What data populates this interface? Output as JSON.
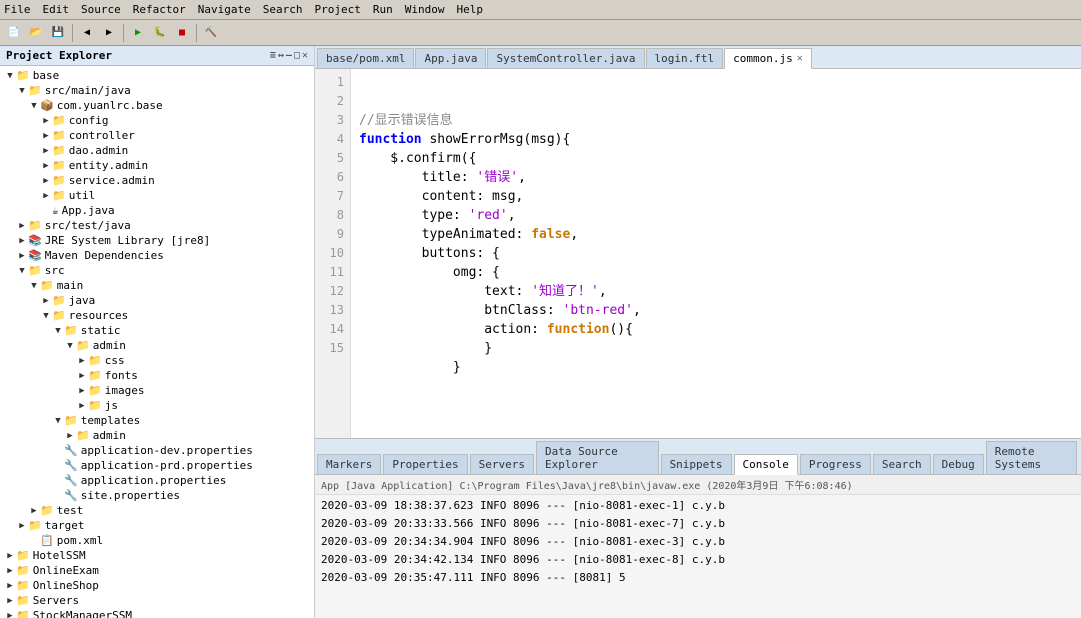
{
  "menubar": {
    "items": [
      "File",
      "Edit",
      "Source",
      "Refactor",
      "Navigate",
      "Search",
      "Project",
      "Run",
      "Window",
      "Help"
    ]
  },
  "sidebar": {
    "title": "Project Explorer",
    "tree": [
      {
        "indent": 0,
        "arrow": "▼",
        "icon": "📁",
        "label": "base",
        "type": "folder"
      },
      {
        "indent": 1,
        "arrow": "▼",
        "icon": "📁",
        "label": "src/main/java",
        "type": "folder"
      },
      {
        "indent": 2,
        "arrow": "▼",
        "icon": "📦",
        "label": "com.yuanlrc.base",
        "type": "package"
      },
      {
        "indent": 3,
        "arrow": "▶",
        "icon": "📁",
        "label": "config",
        "type": "folder"
      },
      {
        "indent": 3,
        "arrow": "▶",
        "icon": "📁",
        "label": "controller",
        "type": "folder"
      },
      {
        "indent": 3,
        "arrow": "▶",
        "icon": "📁",
        "label": "dao.admin",
        "type": "folder"
      },
      {
        "indent": 3,
        "arrow": "▶",
        "icon": "📁",
        "label": "entity.admin",
        "type": "folder"
      },
      {
        "indent": 3,
        "arrow": "▶",
        "icon": "📁",
        "label": "service.admin",
        "type": "folder"
      },
      {
        "indent": 3,
        "arrow": "▶",
        "icon": "📁",
        "label": "util",
        "type": "folder"
      },
      {
        "indent": 3,
        "arrow": "",
        "icon": "☕",
        "label": "App.java",
        "type": "file"
      },
      {
        "indent": 1,
        "arrow": "▶",
        "icon": "📁",
        "label": "src/test/java",
        "type": "folder"
      },
      {
        "indent": 1,
        "arrow": "▶",
        "icon": "📚",
        "label": "JRE System Library [jre8]",
        "type": "lib"
      },
      {
        "indent": 1,
        "arrow": "▶",
        "icon": "📚",
        "label": "Maven Dependencies",
        "type": "lib"
      },
      {
        "indent": 1,
        "arrow": "▼",
        "icon": "📁",
        "label": "src",
        "type": "folder"
      },
      {
        "indent": 2,
        "arrow": "▼",
        "icon": "📁",
        "label": "main",
        "type": "folder"
      },
      {
        "indent": 3,
        "arrow": "▶",
        "icon": "📁",
        "label": "java",
        "type": "folder"
      },
      {
        "indent": 3,
        "arrow": "▼",
        "icon": "📁",
        "label": "resources",
        "type": "folder"
      },
      {
        "indent": 4,
        "arrow": "▼",
        "icon": "📁",
        "label": "static",
        "type": "folder"
      },
      {
        "indent": 5,
        "arrow": "▼",
        "icon": "📁",
        "label": "admin",
        "type": "folder"
      },
      {
        "indent": 6,
        "arrow": "▶",
        "icon": "📁",
        "label": "css",
        "type": "folder"
      },
      {
        "indent": 6,
        "arrow": "▶",
        "icon": "📁",
        "label": "fonts",
        "type": "folder"
      },
      {
        "indent": 6,
        "arrow": "▶",
        "icon": "📁",
        "label": "images",
        "type": "folder"
      },
      {
        "indent": 6,
        "arrow": "▶",
        "icon": "📁",
        "label": "js",
        "type": "folder"
      },
      {
        "indent": 4,
        "arrow": "▼",
        "icon": "📁",
        "label": "templates",
        "type": "folder"
      },
      {
        "indent": 5,
        "arrow": "▶",
        "icon": "📁",
        "label": "admin",
        "type": "folder"
      },
      {
        "indent": 4,
        "arrow": "",
        "icon": "📄",
        "label": "application-dev.properties",
        "type": "file"
      },
      {
        "indent": 4,
        "arrow": "",
        "icon": "📄",
        "label": "application-prd.properties",
        "type": "file"
      },
      {
        "indent": 4,
        "arrow": "",
        "icon": "📄",
        "label": "application.properties",
        "type": "file"
      },
      {
        "indent": 4,
        "arrow": "",
        "icon": "📄",
        "label": "site.properties",
        "type": "file"
      },
      {
        "indent": 2,
        "arrow": "▶",
        "icon": "📁",
        "label": "test",
        "type": "folder"
      },
      {
        "indent": 1,
        "arrow": "▶",
        "icon": "📁",
        "label": "target",
        "type": "folder"
      },
      {
        "indent": 2,
        "arrow": "",
        "icon": "📄",
        "label": "pom.xml",
        "type": "file"
      },
      {
        "indent": 0,
        "arrow": "▶",
        "icon": "📁",
        "label": "HotelSSM",
        "type": "folder"
      },
      {
        "indent": 0,
        "arrow": "▶",
        "icon": "📁",
        "label": "OnlineExam",
        "type": "folder"
      },
      {
        "indent": 0,
        "arrow": "▶",
        "icon": "📁",
        "label": "OnlineShop",
        "type": "folder"
      },
      {
        "indent": 0,
        "arrow": "▶",
        "icon": "📁",
        "label": "Servers",
        "type": "folder"
      },
      {
        "indent": 0,
        "arrow": "▶",
        "icon": "📁",
        "label": "StockManagerSSM",
        "type": "folder"
      }
    ]
  },
  "tabs": [
    {
      "label": "base/pom.xml",
      "active": false
    },
    {
      "label": "App.java",
      "active": false
    },
    {
      "label": "SystemController.java",
      "active": false
    },
    {
      "label": "login.ftl",
      "active": false
    },
    {
      "label": "common.js",
      "active": true,
      "closeable": true
    }
  ],
  "code": {
    "lines": [
      {
        "num": 1,
        "content": "//显示错误信息",
        "type": "comment"
      },
      {
        "num": 2,
        "content": "function showErrorMsg(msg){",
        "type": "code"
      },
      {
        "num": 3,
        "content": "    $.confirm({",
        "type": "code"
      },
      {
        "num": 4,
        "content": "        title: '错误',",
        "type": "code"
      },
      {
        "num": 5,
        "content": "        content: msg,",
        "type": "code"
      },
      {
        "num": 6,
        "content": "        type: 'red',",
        "type": "code"
      },
      {
        "num": 7,
        "content": "        typeAnimated: false,",
        "type": "code"
      },
      {
        "num": 8,
        "content": "        buttons: {",
        "type": "code"
      },
      {
        "num": 9,
        "content": "            omg: {",
        "type": "code"
      },
      {
        "num": 10,
        "content": "                text: '知道了！',",
        "type": "code"
      },
      {
        "num": 11,
        "content": "                btnClass: 'btn-red',",
        "type": "code"
      },
      {
        "num": 12,
        "content": "                action: function(){",
        "type": "code"
      },
      {
        "num": 13,
        "content": "",
        "type": "code"
      },
      {
        "num": 14,
        "content": "                }",
        "type": "code"
      },
      {
        "num": 15,
        "content": "            }",
        "type": "code"
      }
    ]
  },
  "bottom_tabs": [
    "Markers",
    "Properties",
    "Servers",
    "Data Source Explorer",
    "Snippets",
    "Console",
    "Progress",
    "Search",
    "Debug",
    "Remote Systems"
  ],
  "active_bottom_tab": "Console",
  "console": {
    "header": "App [Java Application] C:\\Program Files\\Java\\jre8\\bin\\javaw.exe (2020年3月9日 下午6:08:46)",
    "lines": [
      "2020-03-09 18:38:37.623    INFO 8096 --- [nio-8081-exec-1] c.y.b",
      "2020-03-09 20:33:33.566    INFO 8096 --- [nio-8081-exec-7] c.y.b",
      "2020-03-09 20:34:34.904    INFO 8096 --- [nio-8081-exec-3] c.y.b",
      "2020-03-09 20:34:42.134    INFO 8096 --- [nio-8081-exec-8] c.y.b",
      "2020-03-09 20:35:47.111    INFO 8096 ---              [8081]  5"
    ]
  }
}
